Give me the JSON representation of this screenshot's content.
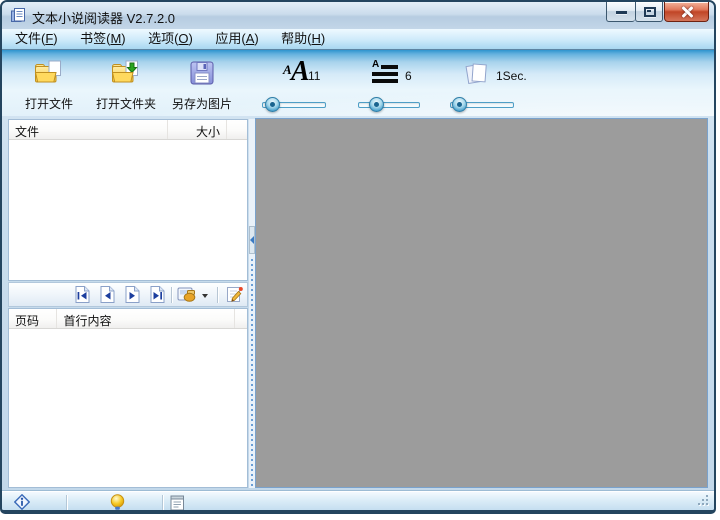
{
  "window": {
    "title": "文本小说阅读器 V2.7.2.0",
    "controls": [
      "minimize",
      "maximize",
      "close"
    ]
  },
  "menu": {
    "items": [
      {
        "label": "文件(F)"
      },
      {
        "label": "书签(M)"
      },
      {
        "label": "选项(O)"
      },
      {
        "label": "应用(A)"
      },
      {
        "label": "帮助(H)"
      }
    ]
  },
  "toolbar": {
    "open_file_label": "打开文件",
    "open_folder_label": "打开文件夹",
    "save_image_label": "另存为图片",
    "font_size_value": "11",
    "line_spacing_value": "6",
    "page_interval_value": "1Sec.",
    "icons": [
      "open-file-icon",
      "open-folder-icon",
      "save-as-image-icon",
      "font-size-icon",
      "line-spacing-icon",
      "page-interval-icon"
    ]
  },
  "file_list": {
    "columns": [
      "文件",
      "大小"
    ],
    "rows": []
  },
  "page_nav": {
    "icons": [
      "first-page-icon",
      "prev-page-icon",
      "next-page-icon",
      "last-page-icon",
      "bookmark-icon",
      "edit-icon"
    ]
  },
  "page_list": {
    "columns": [
      "页码",
      "首行内容"
    ],
    "rows": []
  },
  "statusbar": {
    "icons": [
      "info-icon",
      "tip-icon",
      "notes-icon"
    ]
  },
  "colors": {
    "accent_blue": "#2e94ce",
    "close_red": "#c14526",
    "reading_bg": "#9c9c9c"
  }
}
